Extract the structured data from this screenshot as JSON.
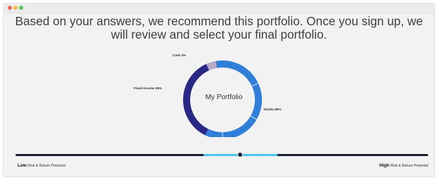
{
  "colors": {
    "dot_close": "#f06a5e",
    "dot_min": "#f5bf4f",
    "dot_max": "#5bc65a",
    "cash": "#b9a9c9",
    "fixed_income": "#2a2a86",
    "stocks": "#2f7fd9",
    "slider_track": "#1c2233",
    "slider_highlight": "#46c6f0"
  },
  "headline": "Based on your answers, we recommend this portfolio. Once you sign up, we will review and select your final portfolio.",
  "portfolio": {
    "center_label": "My Portfolio",
    "segments": [
      {
        "label": "Cash 4%",
        "percent": 4
      },
      {
        "label": "Fixed Income 36%",
        "percent": 36
      },
      {
        "label": "Stocks 60%",
        "percent": 60
      }
    ]
  },
  "risk_slider": {
    "value": 0.545,
    "highlight_start": 0.455,
    "highlight_end": 0.635,
    "low_bold": "Low",
    "low_text": " Risk & Return Potential",
    "high_bold": "High",
    "high_text": " Risk & Return Potential"
  }
}
